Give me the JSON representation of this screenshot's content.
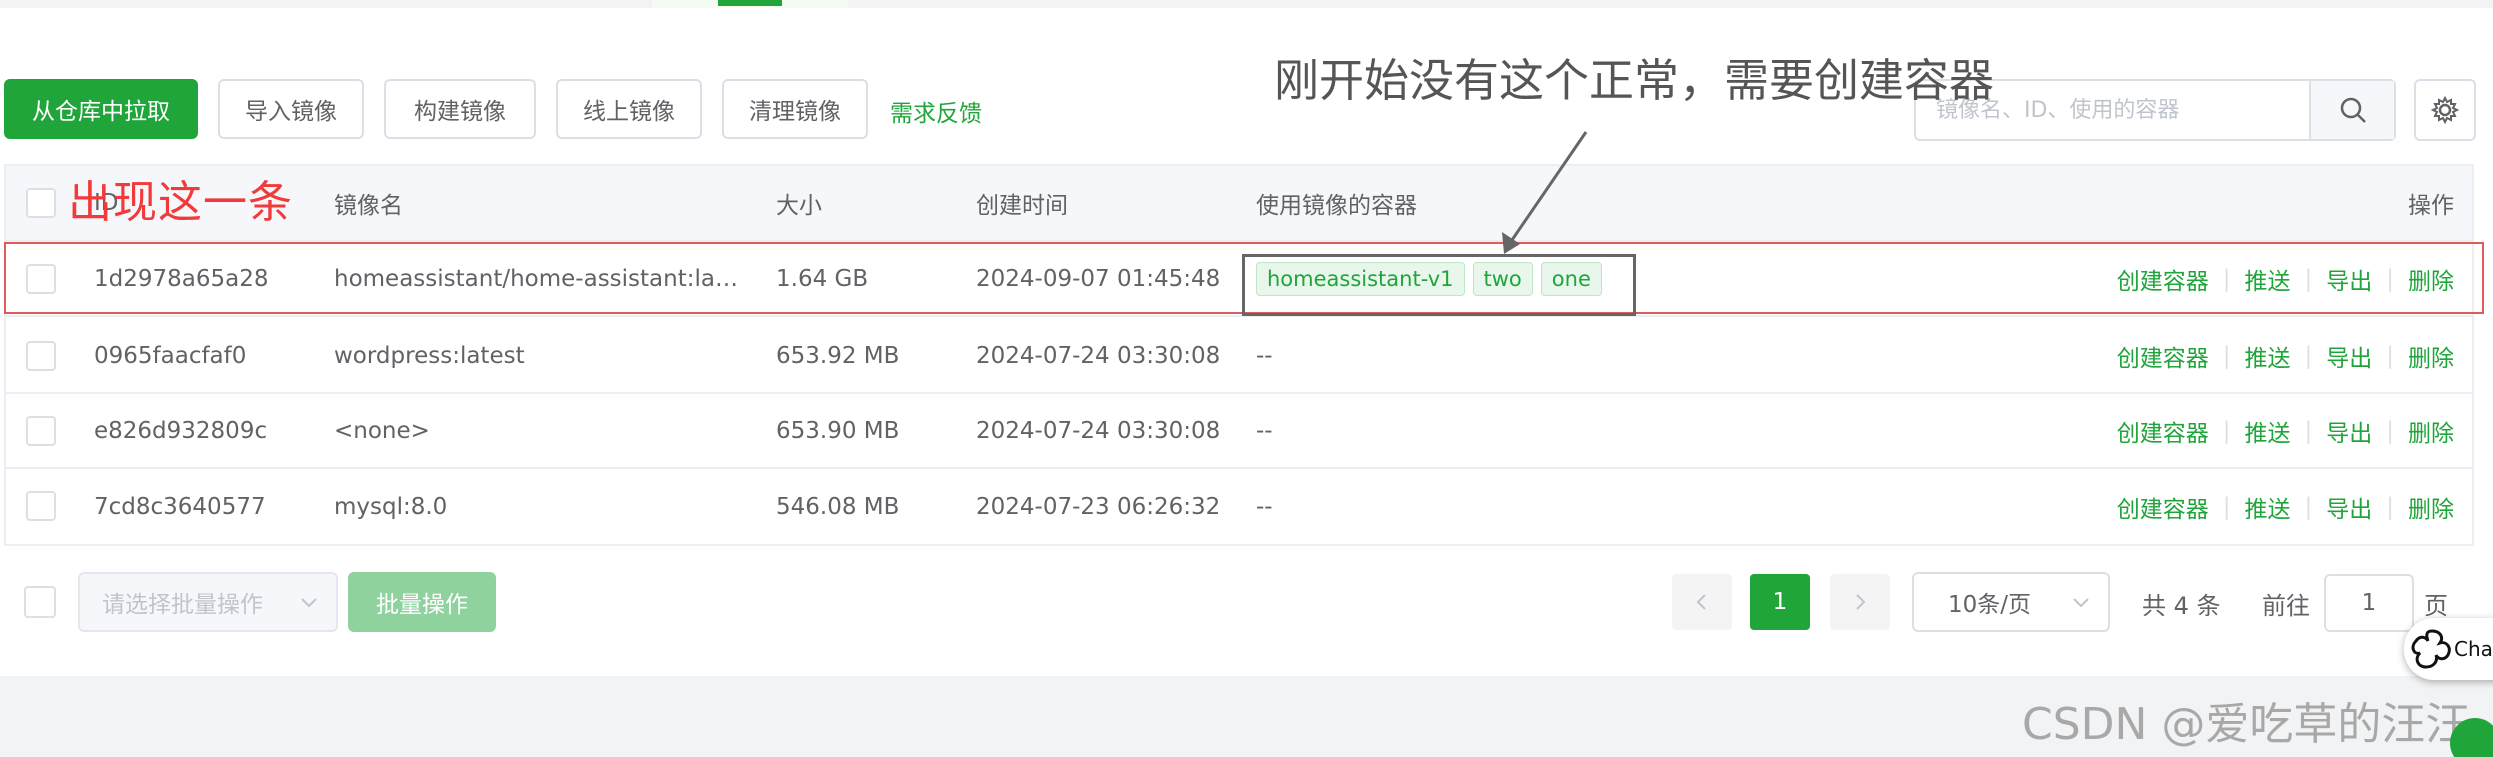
{
  "toolbar": {
    "pull_label": "从仓库中拉取",
    "import_label": "导入镜像",
    "build_label": "构建镜像",
    "online_label": "线上镜像",
    "clean_label": "清理镜像",
    "feedback_label": "需求反馈"
  },
  "search": {
    "placeholder": "镜像名、ID、使用的容器",
    "icon": "search-icon"
  },
  "settings": {
    "icon": "gear-icon"
  },
  "table": {
    "headers": {
      "id": "ID",
      "name": "镜像名",
      "size": "大小",
      "created": "创建时间",
      "containers": "使用镜像的容器",
      "ops": "操作"
    },
    "rows": [
      {
        "id": "1d2978a65a28",
        "name": "homeassistant/home-assistant:la…",
        "size": "1.64 GB",
        "created": "2024-09-07 01:45:48",
        "containers": [
          "homeassistant-v1",
          "two",
          "one"
        ],
        "containers_empty": ""
      },
      {
        "id": "0965faacfaf0",
        "name": "wordpress:latest",
        "size": "653.92 MB",
        "created": "2024-07-24 03:30:08",
        "containers_empty": "--"
      },
      {
        "id": "e826d932809c",
        "name": "<none>",
        "size": "653.90 MB",
        "created": "2024-07-24 03:30:08",
        "containers_empty": "--"
      },
      {
        "id": "7cd8c3640577",
        "name": "mysql:8.0",
        "size": "546.08 MB",
        "created": "2024-07-23 06:26:32",
        "containers_empty": "--"
      }
    ],
    "ops": {
      "create": "创建容器",
      "push": "推送",
      "export": "导出",
      "delete": "删除",
      "sep": "|"
    }
  },
  "batch": {
    "select_placeholder": "请选择批量操作",
    "button_label": "批量操作"
  },
  "pagination": {
    "current": "1",
    "page_size": "10条/页",
    "total": "共 4 条",
    "goto_label": "前往",
    "goto_value": "1",
    "page_unit": "页"
  },
  "annotations": {
    "red_text": "出现这一条",
    "gray_text": "刚开始没有这个正常，需要创建容器",
    "red_color": "#f23a3a"
  },
  "watermark": "CSDN @爱吃草的汪汪",
  "chat_widget_label": "Cha",
  "colors": {
    "accent": "#20a53a",
    "border": "#dcdfe6"
  }
}
